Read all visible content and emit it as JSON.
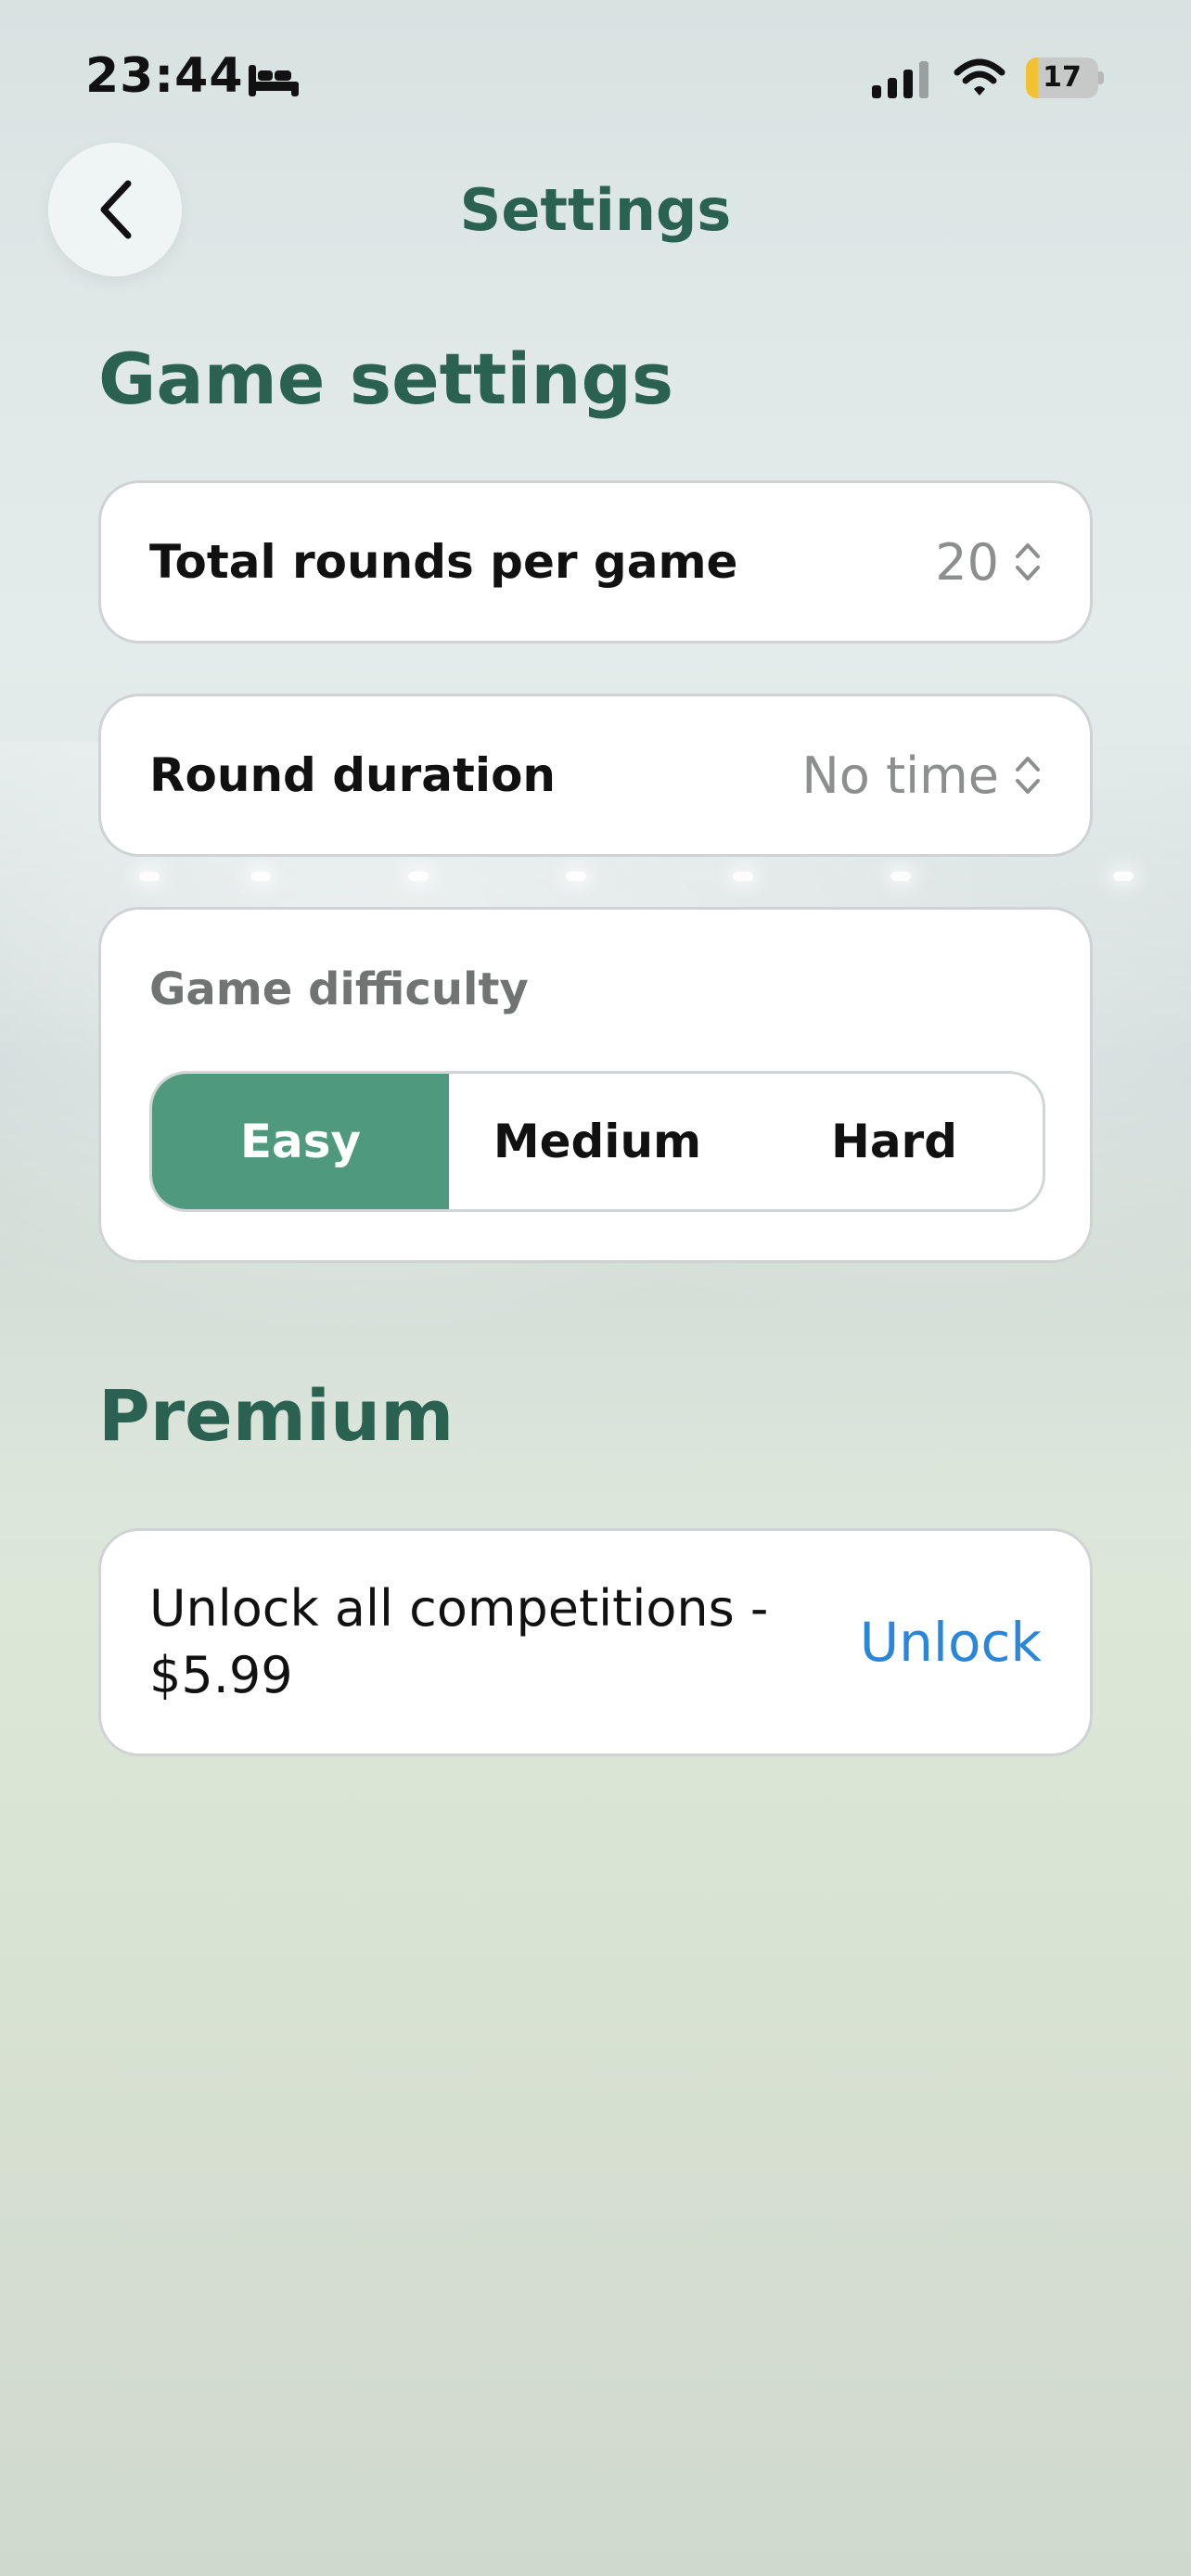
{
  "status_bar": {
    "time": "23:44",
    "battery": "17",
    "battery_level": 0.17
  },
  "nav": {
    "title": "Settings"
  },
  "game_settings": {
    "heading": "Game settings",
    "rounds": {
      "label": "Total rounds per game",
      "value": "20"
    },
    "duration": {
      "label": "Round duration",
      "value": "No time"
    },
    "difficulty": {
      "label": "Game difficulty",
      "options": [
        "Easy",
        "Medium",
        "Hard"
      ],
      "selected": "Easy"
    }
  },
  "premium": {
    "heading": "Premium",
    "item": {
      "text": "Unlock all competitions - $5.99",
      "action": "Unlock"
    }
  },
  "colors": {
    "accent": "#2b6151",
    "selected": "#4f9a7e",
    "link": "#2a86d8"
  }
}
